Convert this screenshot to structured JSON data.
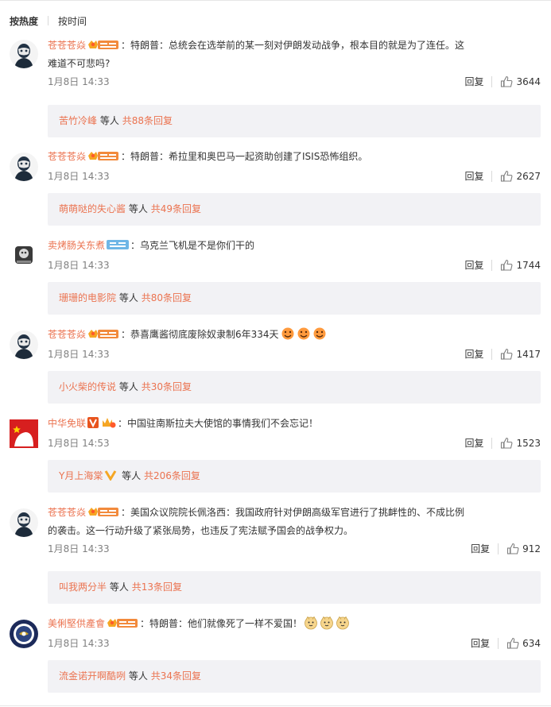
{
  "sort": {
    "hot": "按热度",
    "time": "按时间"
  },
  "reply_label": "回复",
  "reply_mid": "等人",
  "comments": [
    {
      "avatar": "mask-avatar",
      "username": "苍苍苍焱",
      "badges": [
        "fan-badge"
      ],
      "text": "：特朗普：总统会在选举前的某一刻对伊朗发动战争，根本目的就是为了连任。这难道不可悲吗？",
      "line1": "：特朗普：总统会在选举前的某一刻对伊朗发动战争，根本目的就是为了连任。这",
      "line2": "难道不可悲吗?",
      "time": "1月8日 14:33",
      "likes": "3644",
      "reply_user": "苦竹冷峰",
      "reply_total": "共88条回复"
    },
    {
      "avatar": "mask-avatar",
      "username": "苍苍苍焱",
      "badges": [
        "fan-badge"
      ],
      "line1": "：特朗普：希拉里和奥巴马一起资助创建了ISIS恐怖组织。",
      "time": "1月8日 14:33",
      "likes": "2627",
      "reply_user": "萌萌哒的失心酱",
      "reply_total": "共49条回复"
    },
    {
      "avatar": "skull-avatar",
      "username": "卖烤肠关东煮",
      "badges": [
        "iron-fan-badge"
      ],
      "line1": "：乌克兰飞机是不是你们干的",
      "time": "1月8日 14:33",
      "likes": "1744",
      "reply_user": "珊珊的电影院",
      "reply_total": "共80条回复"
    },
    {
      "avatar": "mask-avatar",
      "username": "苍苍苍焱",
      "badges": [
        "fan-badge"
      ],
      "line1": "：恭喜鹰酱彻底废除奴隶制6年334天",
      "emoji_count": 3,
      "time": "1月8日 14:33",
      "likes": "1417",
      "reply_user": "小火柴的传说",
      "reply_total": "共30条回复"
    },
    {
      "avatar": "flag-avatar",
      "username": "中华免联",
      "badges": [
        "verified-v-badge",
        "crown-badge"
      ],
      "line1": "：中国驻南斯拉夫大使馆的事情我们不会忘记！",
      "time": "1月8日 14:53",
      "likes": "1523",
      "reply_user": "Y月上海棠",
      "reply_has_v": true,
      "reply_total": "共206条回复"
    },
    {
      "avatar": "mask-avatar",
      "username": "苍苍苍焱",
      "badges": [
        "fan-badge"
      ],
      "line1": "：美国众议院院长佩洛西：我国政府针对伊朗高级军官进行了挑衅性的、不成比例",
      "line2": "的袭击。这一行动升级了紧张局势，也违反了宪法赋予国会的战争权力。",
      "time": "1月8日 14:33",
      "likes": "912",
      "reply_user": "叫我两分半",
      "reply_total": "共13条回复"
    },
    {
      "avatar": "seal-avatar",
      "username": "美俐堅供產會",
      "badges": [
        "fan-badge"
      ],
      "line1": "：特朗普：他们就像死了一样不爱国！",
      "emoji_count": 3,
      "time": "1月8日 14:33",
      "likes": "634",
      "reply_user": "流金诺开啊酷咧",
      "reply_total": "共34条回复"
    }
  ],
  "colors": {
    "link": "#eb7350",
    "muted": "#808080",
    "reply_bg": "#f2f2f5"
  }
}
